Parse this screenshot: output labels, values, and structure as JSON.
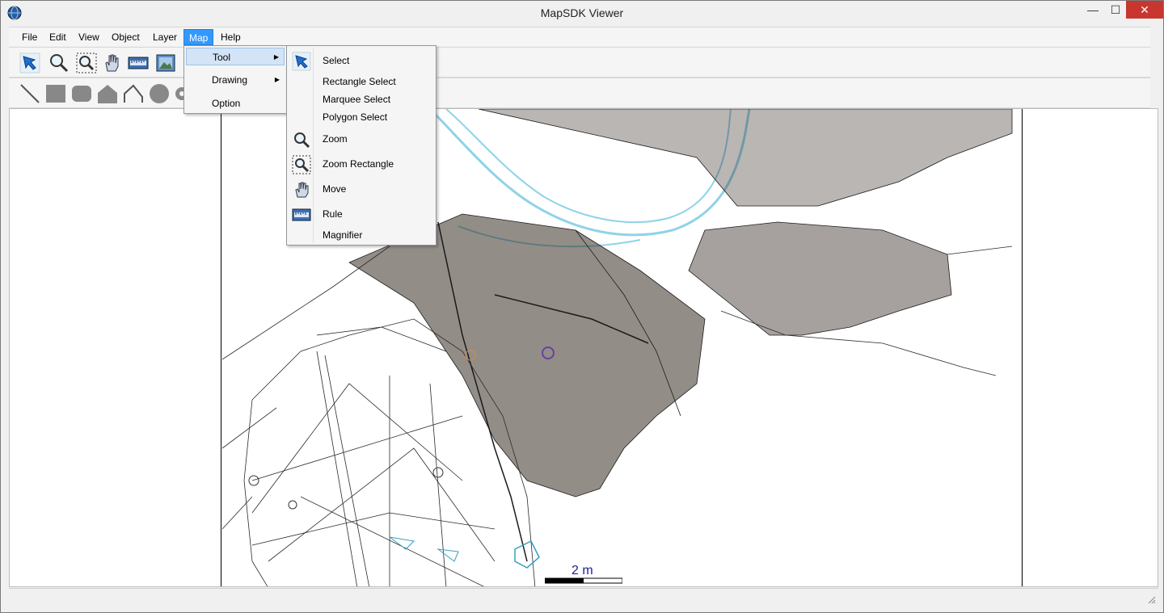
{
  "window": {
    "title": "MapSDK Viewer",
    "close_glyph": "✕",
    "min_glyph": "—",
    "max_glyph": "☐"
  },
  "menubar": {
    "items": [
      {
        "label": "File"
      },
      {
        "label": "Edit"
      },
      {
        "label": "View"
      },
      {
        "label": "Object"
      },
      {
        "label": "Layer"
      },
      {
        "label": "Map"
      },
      {
        "label": "Help"
      }
    ]
  },
  "map_menu": {
    "items": [
      {
        "label": "Tool",
        "has_submenu": true
      },
      {
        "label": "Drawing",
        "has_submenu": true
      },
      {
        "label": "Option",
        "has_submenu": false
      }
    ],
    "submenu_arrow": "▶"
  },
  "tool_submenu": {
    "items": [
      {
        "label": "Select",
        "icon": "select-arrow-icon"
      },
      {
        "label": "Rectangle Select",
        "icon": ""
      },
      {
        "label": "Marquee Select",
        "icon": ""
      },
      {
        "label": "Polygon Select",
        "icon": ""
      },
      {
        "label": "Zoom",
        "icon": "zoom-icon"
      },
      {
        "label": "Zoom Rectangle",
        "icon": "zoom-rectangle-icon"
      },
      {
        "label": "Move",
        "icon": "hand-icon"
      },
      {
        "label": "Rule",
        "icon": "ruler-icon"
      },
      {
        "label": "Magnifier",
        "icon": ""
      }
    ]
  },
  "toolbar_main": [
    "select-arrow-icon",
    "zoom-icon",
    "zoom-rectangle-icon",
    "hand-icon",
    "ruler-icon",
    "export-image-icon"
  ],
  "toolbar_draw": [
    "line-icon",
    "rectangle-icon",
    "rounded-rectangle-icon",
    "polygon-icon",
    "polyline-icon",
    "circle-icon",
    "gear-icon"
  ],
  "map": {
    "scale_label": "2 m"
  },
  "colors": {
    "menu_highlight": "#3399ff",
    "submenu_highlight": "#d3e4f7",
    "river": "#8fd3e8",
    "roads": "#1a1a1a",
    "scale": "#1a1aa0",
    "close": "#c7372f"
  }
}
